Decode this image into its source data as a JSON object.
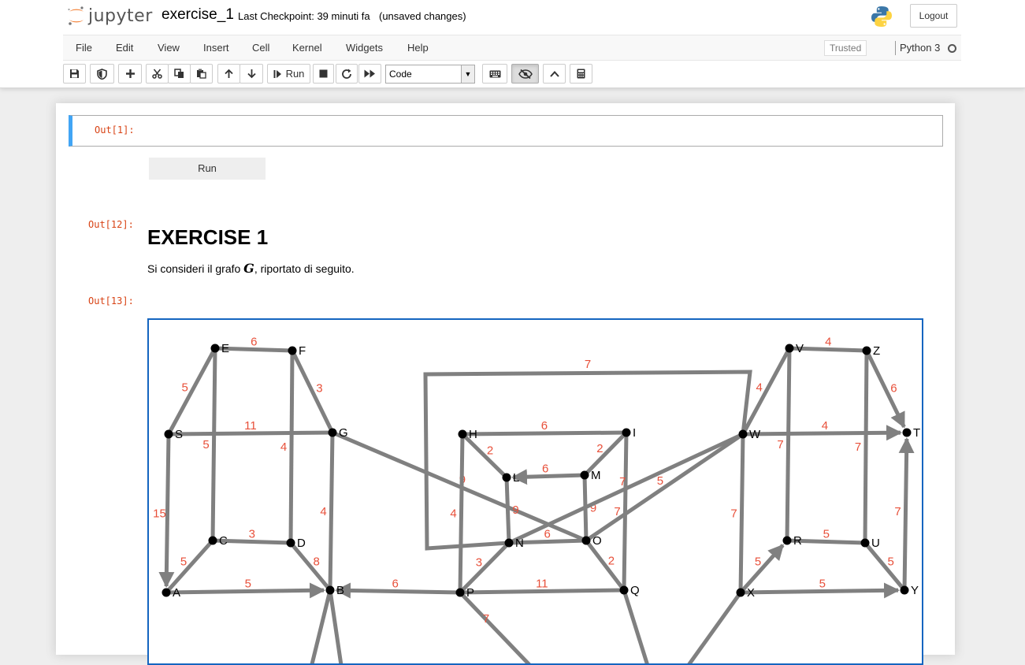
{
  "header": {
    "logo_text": "jupyter",
    "notebook_name": "exercise_1",
    "checkpoint": "Last Checkpoint: 39 minuti fa",
    "autosave": "(unsaved changes)",
    "logout_label": "Logout"
  },
  "menubar": {
    "items": [
      "File",
      "Edit",
      "View",
      "Insert",
      "Cell",
      "Kernel",
      "Widgets",
      "Help"
    ],
    "trusted": "Trusted",
    "kernel": "Python 3"
  },
  "toolbar": {
    "run_label": "Run",
    "cell_type": "Code",
    "buttons": [
      "save-icon",
      "shield-icon",
      "plus-icon",
      "cut-icon",
      "copy-icon",
      "paste-icon",
      "arrow-up-icon",
      "arrow-down-icon",
      "run-icon",
      "stop-icon",
      "restart-icon",
      "fast-forward-icon",
      "keyboard-icon",
      "eye-slash-icon",
      "chevron-up-icon",
      "calculator-icon"
    ]
  },
  "cells": {
    "out1_prompt": "Out[1]:",
    "run_button": "Run",
    "out12_prompt": "Out[12]:",
    "exercise_title": "EXERCISE 1",
    "desc_before": "Si consideri il grafo ",
    "desc_math": "G",
    "desc_after": ", riportato di seguito.",
    "out13_prompt": "Out[13]:"
  },
  "graph": {
    "nodes": [
      {
        "id": "E",
        "label": "E"
      },
      {
        "id": "F",
        "label": "F"
      },
      {
        "id": "S",
        "label": "S"
      },
      {
        "id": "G",
        "label": "G"
      },
      {
        "id": "C",
        "label": "C"
      },
      {
        "id": "D",
        "label": "D"
      },
      {
        "id": "A",
        "label": "A"
      },
      {
        "id": "B",
        "label": "B"
      },
      {
        "id": "H",
        "label": "H"
      },
      {
        "id": "I",
        "label": "I"
      },
      {
        "id": "L",
        "label": "L"
      },
      {
        "id": "M",
        "label": "M"
      },
      {
        "id": "N",
        "label": "N"
      },
      {
        "id": "O",
        "label": "O"
      },
      {
        "id": "P",
        "label": "P"
      },
      {
        "id": "Q",
        "label": "Q"
      },
      {
        "id": "W",
        "label": "W"
      },
      {
        "id": "V",
        "label": "V"
      },
      {
        "id": "Z",
        "label": "Z"
      },
      {
        "id": "T",
        "label": "T"
      },
      {
        "id": "R",
        "label": "R"
      },
      {
        "id": "U",
        "label": "U"
      },
      {
        "id": "X",
        "label": "X"
      },
      {
        "id": "Y",
        "label": "Y"
      }
    ],
    "edges": [
      {
        "from": "E",
        "to": "F",
        "w": "6"
      },
      {
        "from": "E",
        "to": "S",
        "w": "5"
      },
      {
        "from": "F",
        "to": "G",
        "w": "3"
      },
      {
        "from": "S",
        "to": "G",
        "w": "11"
      },
      {
        "from": "E",
        "to": "C",
        "w": "5"
      },
      {
        "from": "F",
        "to": "D",
        "w": "4"
      },
      {
        "from": "S",
        "to": "A",
        "w": "15",
        "dir": true
      },
      {
        "from": "G",
        "to": "B",
        "w": "4"
      },
      {
        "from": "C",
        "to": "D",
        "w": "3"
      },
      {
        "from": "C",
        "to": "A",
        "w": "5"
      },
      {
        "from": "D",
        "to": "B",
        "w": "8"
      },
      {
        "from": "A",
        "to": "B",
        "w": "5",
        "dir": true
      },
      {
        "from": "P",
        "to": "B",
        "w": "6",
        "dir": true
      },
      {
        "from": "G",
        "to": "O",
        "w": "9"
      },
      {
        "from": "H",
        "to": "I",
        "w": "6"
      },
      {
        "from": "H",
        "to": "L",
        "w": "2"
      },
      {
        "from": "I",
        "to": "M",
        "w": "2"
      },
      {
        "from": "M",
        "to": "L",
        "w": "6",
        "dir": true
      },
      {
        "from": "H",
        "to": "P",
        "w": "4"
      },
      {
        "from": "L",
        "to": "N",
        "w": "9"
      },
      {
        "from": "M",
        "to": "O",
        "w": "9"
      },
      {
        "from": "I",
        "to": "Q",
        "w": "7"
      },
      {
        "from": "N",
        "to": "O",
        "w": "6"
      },
      {
        "from": "P",
        "to": "N",
        "w": "3"
      },
      {
        "from": "O",
        "to": "Q",
        "w": "2"
      },
      {
        "from": "P",
        "to": "Q",
        "w": "11"
      },
      {
        "from": "W",
        "to": "O",
        "w": "5"
      },
      {
        "from": "W",
        "to": "N",
        "w": "7"
      },
      {
        "from": "W",
        "to": "V",
        "w": "4"
      },
      {
        "from": "W",
        "to": "T",
        "w": "4",
        "dir": true
      },
      {
        "from": "V",
        "to": "Z",
        "w": "4"
      },
      {
        "from": "Z",
        "to": "T",
        "w": "6",
        "dir": true
      },
      {
        "from": "V",
        "to": "R",
        "w": "7"
      },
      {
        "from": "Z",
        "to": "U",
        "w": "7"
      },
      {
        "from": "W",
        "to": "X",
        "w": "7"
      },
      {
        "from": "R",
        "to": "U",
        "w": "5"
      },
      {
        "from": "X",
        "to": "R",
        "w": "5",
        "dir": true
      },
      {
        "from": "U",
        "to": "Y",
        "w": "5"
      },
      {
        "from": "Y",
        "to": "T",
        "w": "7",
        "dir": true
      },
      {
        "from": "X",
        "to": "Y",
        "w": "5",
        "dir": true
      }
    ],
    "loop_label": "7",
    "bottom_label": "7"
  },
  "colors": {
    "edge": "#808080",
    "weight": "#e8503a",
    "frame": "#1565c0",
    "prompt": "#d84315",
    "selected_cell": "#42a5f5"
  }
}
